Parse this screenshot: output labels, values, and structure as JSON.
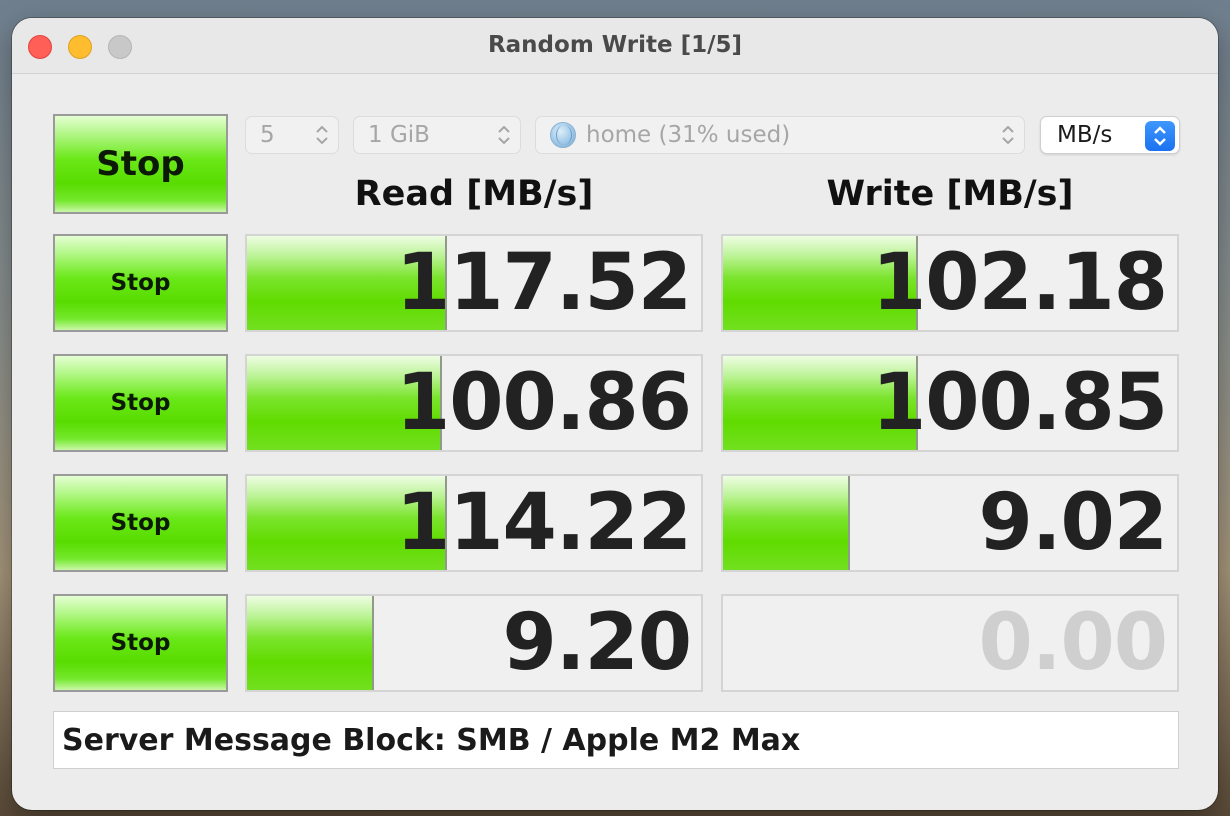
{
  "window": {
    "title": "Random Write [1/5]"
  },
  "controls": {
    "main_button": "Stop",
    "count": "5",
    "size": "1 GiB",
    "target": "home (31% used)",
    "unit": "MB/s"
  },
  "headers": {
    "read": "Read [MB/s]",
    "write": "Write [MB/s]"
  },
  "rows": [
    {
      "button": "Stop",
      "read": "117.52",
      "read_level": 0.44,
      "write": "102.18",
      "write_level": 0.43
    },
    {
      "button": "Stop",
      "read": "100.86",
      "read_level": 0.43,
      "write": "100.85",
      "write_level": 0.43
    },
    {
      "button": "Stop",
      "read": "114.22",
      "read_level": 0.44,
      "write": "9.02",
      "write_level": 0.28
    },
    {
      "button": "Stop",
      "read": "9.20",
      "read_level": 0.28,
      "write": "0.00",
      "write_level": 0.0
    }
  ],
  "status_message": "Server Message Block: SMB / Apple M2 Max",
  "colors": {
    "bar_green": "#60dc00",
    "dim_text": "#cfcfcf"
  }
}
